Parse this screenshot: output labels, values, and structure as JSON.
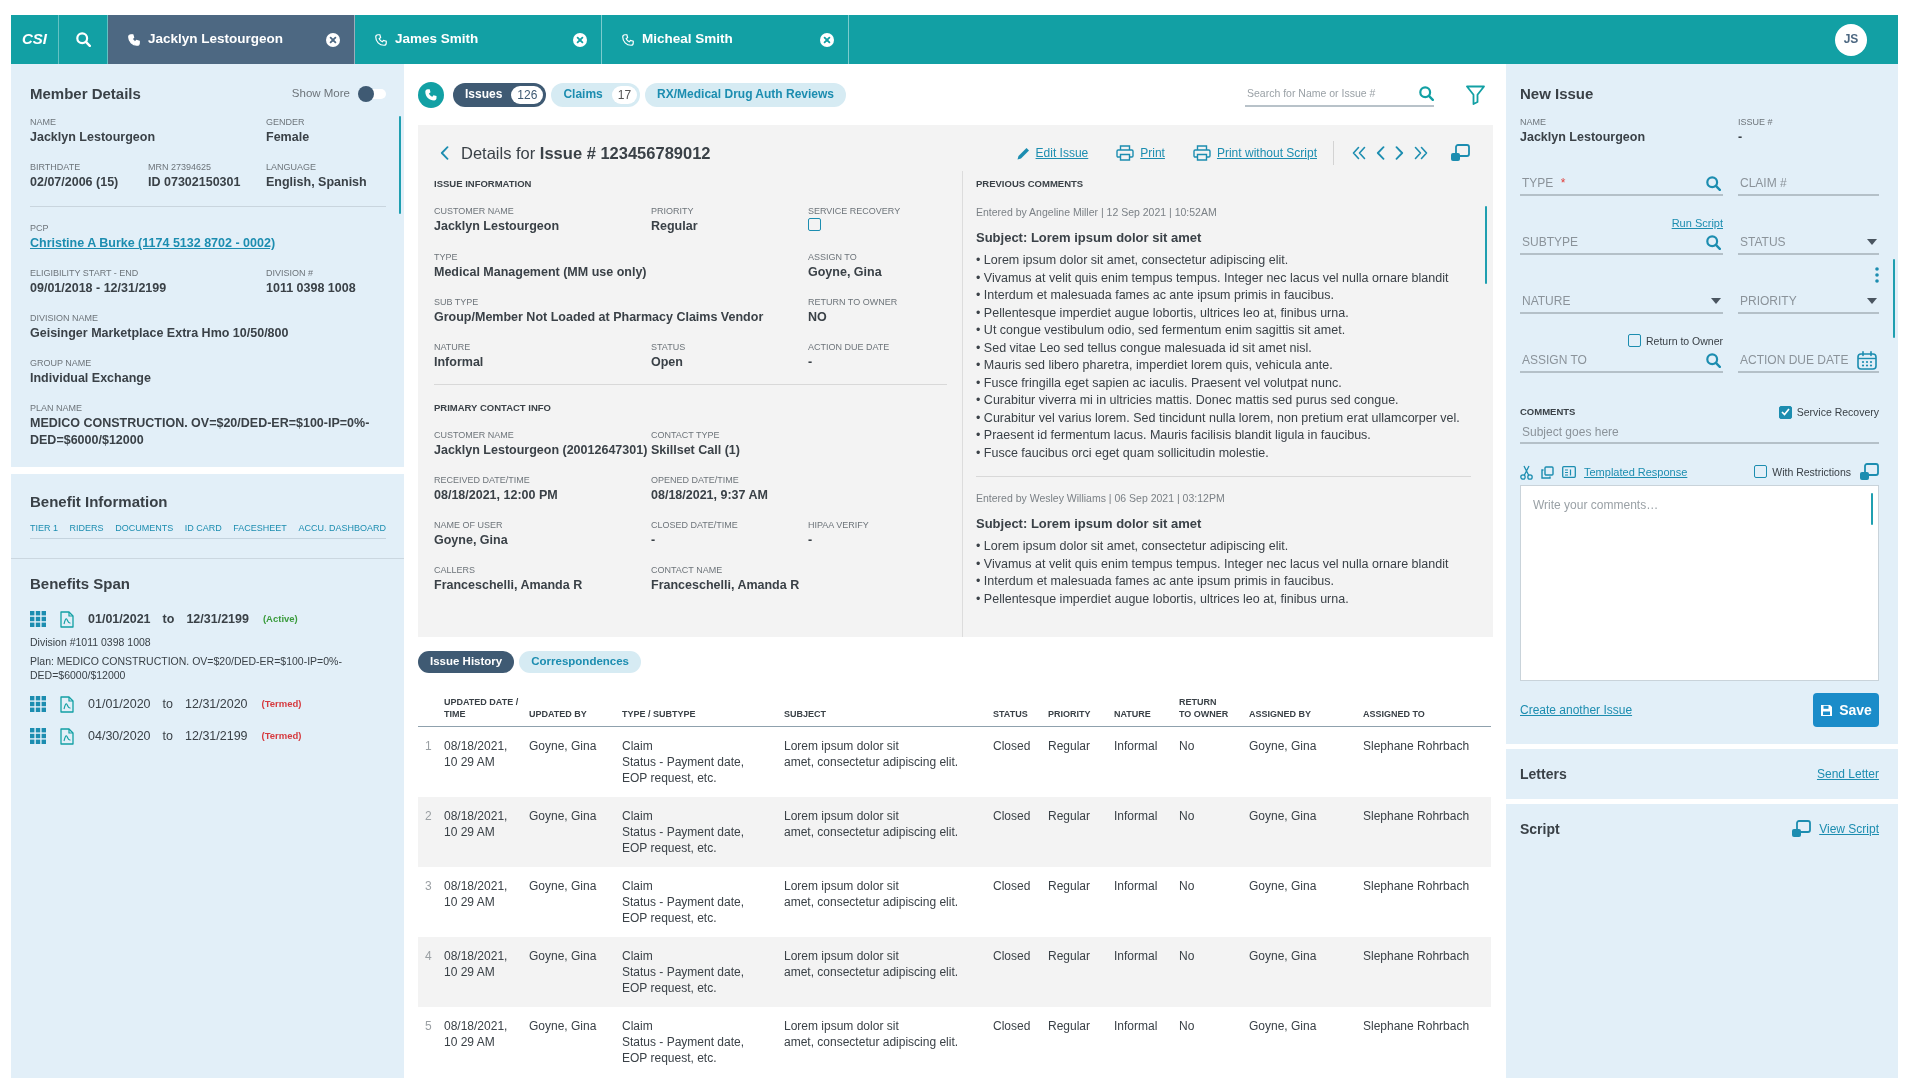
{
  "top_bar": {
    "logo": "CSI",
    "tabs": [
      {
        "label": "Jacklyn Lestourgeon",
        "selected": true
      },
      {
        "label": "James Smith",
        "selected": false
      },
      {
        "label": "Micheal Smith",
        "selected": false
      }
    ],
    "user_initials": "JS"
  },
  "member_details": {
    "title": "Member Details",
    "show_more": {
      "label": "Show More",
      "on": false
    },
    "groups": [
      [
        [
          {
            "label": "NAME",
            "value": "Jacklyn Lestourgeon",
            "kind": "text"
          },
          {
            "label": "GENDER",
            "value": "Female",
            "kind": "text"
          }
        ],
        [
          {
            "label": "BIRTHDATE",
            "value": "02/07/2006 (15)",
            "kind": "text"
          },
          {
            "label": "MRN 27394625",
            "value": "ID 07302150301",
            "kind": "text"
          },
          {
            "label": "LANGUAGE",
            "value": "English, Spanish",
            "kind": "text"
          }
        ]
      ],
      [
        [
          {
            "label": "PCP",
            "value": "Christine A Burke (1174 5132 8702 - 0002)",
            "kind": "link"
          }
        ],
        [
          {
            "label": "ELIGIBILITY START - END",
            "value": "09/01/2018 - 12/31/2199",
            "kind": "text"
          },
          {
            "label": "DIVISION #",
            "value": "1011 0398 1008",
            "kind": "text"
          }
        ],
        [
          {
            "label": "DIVISION NAME",
            "value": "Geisinger Marketplace Extra Hmo 10/50/800",
            "kind": "text"
          }
        ],
        [
          {
            "label": "GROUP NAME",
            "value": "Individual Exchange",
            "kind": "text"
          }
        ],
        [
          {
            "label": "PLAN NAME",
            "value": "MEDICO CONSTRUCTION. OV=$20/DED-ER=$100-IP=0%-DED=$6000/$12000",
            "kind": "text"
          }
        ]
      ]
    ]
  },
  "benefit_information": {
    "title": "Benefit Information",
    "links": [
      "TIER 1",
      "RIDERS",
      "DOCUMENTS",
      "ID CARD",
      "FACESHEET",
      "ACCU. DASHBOARD"
    ]
  },
  "benefits_span": {
    "title": "Benefits Span",
    "spans": [
      {
        "start": "01/01/2021",
        "joiner": "to",
        "end": "12/31/2199",
        "status": "(Active)",
        "color": "#3a9b3c",
        "expanded": true,
        "details": [
          "Division #1011 0398 1008",
          "Plan: MEDICO CONSTRUCTION. OV=$20/DED-ER=$100-IP=0%-DED=$6000/$12000"
        ]
      },
      {
        "start": "01/01/2020",
        "joiner": "to",
        "end": "12/31/2020",
        "status": "(Termed)",
        "color": "#d63a3f",
        "expanded": false
      },
      {
        "start": "04/30/2020",
        "joiner": "to",
        "end": "12/31/2199",
        "status": "(Termed)",
        "color": "#d63a3f",
        "expanded": false
      }
    ]
  },
  "record_tabs": [
    {
      "label": "Issues",
      "count": "126",
      "selected": true
    },
    {
      "label": "Claims",
      "count": "17",
      "selected": false
    },
    {
      "label": "RX/Medical Drug Auth Reviews",
      "selected": false
    }
  ],
  "search": {
    "placeholder": "Search for Name or Issue #"
  },
  "issue_details": {
    "title": "Details for **Issue # 123456789012**",
    "actions": [
      {
        "label": "Edit Issue",
        "kind": "edit"
      },
      {
        "label": "Print",
        "kind": "print"
      },
      {
        "label": "Print without Script",
        "kind": "print"
      }
    ],
    "sections": [
      {
        "heading": "ISSUE INFORMATION",
        "rows": [
          [
            {
              "label": "CUSTOMER NAME",
              "value": "Jacklyn Lestourgeon",
              "kind": "text"
            },
            {
              "label": "PRIORITY",
              "value": "Regular",
              "kind": "text"
            },
            {
              "label": "SERVICE RECOVERY",
              "kind": "checkbox",
              "checked": false
            }
          ],
          [
            {
              "label": "TYPE",
              "value": "Medical Management (MM use only)",
              "kind": "text"
            },
            {
              "label": "ASSIGN TO",
              "value": "Goyne, Gina",
              "kind": "text"
            }
          ],
          [
            {
              "label": "SUB TYPE",
              "value": "Group/Member Not Loaded at Pharmacy Claims Vendor",
              "kind": "text"
            },
            {
              "label": "RETURN TO OWNER",
              "value": "NO",
              "kind": "text"
            }
          ],
          [
            {
              "label": "NATURE",
              "value": "Informal",
              "kind": "text"
            },
            {
              "label": "STATUS",
              "value": "Open",
              "kind": "text"
            },
            {
              "label": "ACTION DUE DATE",
              "value": "-",
              "kind": "text"
            }
          ]
        ]
      },
      {
        "heading": "PRIMARY CONTACT INFO",
        "rows": [
          [
            {
              "label": "CUSTOMER NAME",
              "value": "Jacklyn Lestourgeon (20012647301)",
              "kind": "text"
            },
            {
              "label": "CONTACT TYPE",
              "value": "Skillset Call (1)",
              "kind": "text"
            }
          ],
          [
            {
              "label": "RECEIVED DATE/TIME",
              "value": "08/18/2021, 12:00 PM",
              "kind": "text"
            },
            {
              "label": "OPENED DATE/TIME",
              "value": "08/18/2021, 9:37 AM",
              "kind": "text"
            }
          ],
          [
            {
              "label": "NAME OF USER",
              "value": "Goyne, Gina",
              "kind": "text"
            },
            {
              "label": "CLOSED DATE/TIME",
              "value": "-",
              "kind": "text"
            },
            {
              "label": "HIPAA VERIFY",
              "value": "-",
              "kind": "text"
            }
          ],
          [
            {
              "label": "CALLERS",
              "value": "Franceschelli, Amanda R",
              "kind": "text"
            },
            {
              "label": "CONTACT NAME",
              "value": "Franceschelli, Amanda R",
              "kind": "text"
            }
          ]
        ]
      }
    ],
    "previous_comments": {
      "heading": "PREVIOUS COMMENTS",
      "entries": [
        {
          "meta": "Entered by Angeline Miller | 12 Sep 2021 | 10:52AM",
          "subject": "Subject: Lorem ipsum dolor sit amet",
          "lines": [
            "• Lorem ipsum dolor sit amet, consectetur adipiscing elit.",
            "• Vivamus at velit quis enim tempus tempus. Integer nec lacus vel nulla ornare blandit",
            "• Interdum et malesuada fames ac ante ipsum primis in faucibus.",
            "• Pellentesque imperdiet augue lobortis, ultrices leo at, finibus urna.",
            "• Ut congue vestibulum odio, sed fermentum enim sagittis sit amet.",
            "• Sed vitae Leo sed tellus congue malesuada id sit amet nisl.",
            "• Mauris sed libero pharetra, imperdiet lorem quis, vehicula ante.",
            "• Fusce fringilla eget sapien ac iaculis. Praesent vel volutpat nunc.",
            "• Curabitur viverra mi in ultricies mattis. Donec mattis sed purus sed congue.",
            "• Curabitur vel varius lorem. Sed tincidunt nulla lorem, non pretium erat ullamcorper vel.",
            "• Praesent id fermentum lacus. Mauris facilisis blandit ligula in faucibus.",
            "• Fusce faucibus orci eget quam sollicitudin molestie."
          ]
        },
        {
          "meta": "Entered by Wesley Williams | 06 Sep 2021 | 03:12PM",
          "subject": "Subject: Lorem ipsum dolor sit amet",
          "lines": [
            "• Lorem ipsum dolor sit amet, consectetur adipiscing elit.",
            "• Vivamus at velit quis enim tempus tempus. Integer nec lacus vel nulla ornare blandit",
            "• Interdum et malesuada fames ac ante ipsum primis in faucibus.",
            "• Pellentesque imperdiet augue lobortis, ultrices leo at, finibus urna."
          ]
        }
      ]
    }
  },
  "history_tabs": [
    {
      "label": "Issue History",
      "selected": true
    },
    {
      "label": "Correspondences",
      "selected": false
    }
  ],
  "history_table": {
    "columns": [
      "UPDATED DATE / TIME",
      "UPDATED BY",
      "TYPE / SUBTYPE",
      "SUBJECT",
      "STATUS",
      "PRIORITY",
      "NATURE",
      "RETURN TO OWNER",
      "ASSIGNED BY",
      "ASSIGNED TO"
    ],
    "rows": [
      {
        "number": "1",
        "updated": "08/18/2021, 10 29 AM",
        "updated_by": "Goyne, Gina",
        "type": "Claim",
        "subtype": "Status - Payment date, EOP request, etc.",
        "subject": [
          "Lorem ipsum dolor sit",
          "amet, consectetur adipiscing elit."
        ],
        "status": "Closed",
        "priority": "Regular",
        "nature": "Informal",
        "return_to_owner": "No",
        "assigned_by": "Goyne, Gina",
        "assigned_to": "Slephane Rohrbach"
      },
      {
        "number": "2",
        "updated": "08/18/2021, 10 29 AM",
        "updated_by": "Goyne, Gina",
        "type": "Claim",
        "subtype": "Status - Payment date, EOP request, etc.",
        "subject": [
          "Lorem ipsum dolor sit",
          "amet, consectetur adipiscing elit."
        ],
        "status": "Closed",
        "priority": "Regular",
        "nature": "Informal",
        "return_to_owner": "No",
        "assigned_by": "Goyne, Gina",
        "assigned_to": "Slephane Rohrbach"
      },
      {
        "number": "3",
        "updated": "08/18/2021, 10 29 AM",
        "updated_by": "Goyne, Gina",
        "type": "Claim",
        "subtype": "Status - Payment date, EOP request, etc.",
        "subject": [
          "Lorem ipsum dolor sit",
          "amet, consectetur adipiscing elit."
        ],
        "status": "Closed",
        "priority": "Regular",
        "nature": "Informal",
        "return_to_owner": "No",
        "assigned_by": "Goyne, Gina",
        "assigned_to": "Slephane Rohrbach"
      },
      {
        "number": "4",
        "updated": "08/18/2021, 10 29 AM",
        "updated_by": "Goyne, Gina",
        "type": "Claim",
        "subtype": "Status - Payment date, EOP request, etc.",
        "subject": [
          "Lorem ipsum dolor sit",
          "amet, consectetur adipiscing elit."
        ],
        "status": "Closed",
        "priority": "Regular",
        "nature": "Informal",
        "return_to_owner": "No",
        "assigned_by": "Goyne, Gina",
        "assigned_to": "Slephane Rohrbach"
      },
      {
        "number": "5",
        "updated": "08/18/2021, 10 29 AM",
        "updated_by": "Goyne, Gina",
        "type": "Claim",
        "subtype": "Status - Payment date, EOP request, etc.",
        "subject": [
          "Lorem ipsum dolor sit",
          "amet, consectetur adipiscing elit."
        ],
        "status": "Closed",
        "priority": "Regular",
        "nature": "Informal",
        "return_to_owner": "No",
        "assigned_by": "Goyne, Gina",
        "assigned_to": "Slephane Rohrbach"
      }
    ]
  },
  "new_issue": {
    "title": "New Issue",
    "info": [
      {
        "label": "NAME",
        "value": "Jacklyn Lestourgeon"
      },
      {
        "label": "ISSUE #",
        "value": "-"
      }
    ],
    "fields": [
      {
        "placeholder": "TYPE",
        "kind": "search",
        "required_mark": "*"
      },
      {
        "placeholder": "CLAIM #",
        "kind": "text"
      },
      {
        "placeholder": "SUBTYPE",
        "kind": "search",
        "link": "Run Script"
      },
      {
        "placeholder": "STATUS",
        "kind": "select"
      },
      {
        "placeholder": "NATURE",
        "kind": "select"
      },
      {
        "placeholder": "PRIORITY",
        "kind": "select"
      },
      {
        "placeholder": "ASSIGN TO",
        "kind": "search",
        "option": {
          "label": "Return to Owner",
          "checked": false
        }
      },
      {
        "placeholder": "ACTION DUE DATE",
        "kind": "date"
      }
    ],
    "comments": {
      "heading": "COMMENTS",
      "service_recovery": {
        "label": "Service Recovery",
        "checked": true
      },
      "subject_placeholder": "Subject goes here",
      "template_link": "Templated Response",
      "restrictions": {
        "label": "With Restrictions",
        "checked": false
      },
      "placeholder": "Write your comments…"
    },
    "create_link": "Create another Issue",
    "save_label": "Save"
  },
  "letters": {
    "title": "Letters",
    "link": "Send Letter"
  },
  "script": {
    "title": "Script",
    "link": "View Script"
  }
}
